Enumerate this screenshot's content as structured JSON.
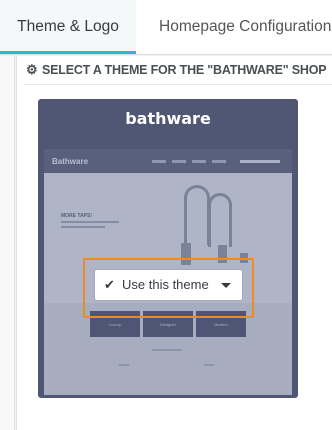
{
  "tabs": [
    {
      "label": "Theme & Logo",
      "active": true
    },
    {
      "label": "Homepage Configuration",
      "active": false
    }
  ],
  "section": {
    "icon": "cogs-icon",
    "title": "SELECT A THEME FOR THE \"BATHWARE\" SHOP"
  },
  "theme": {
    "name": "bathware",
    "preview": {
      "logo": "Bathware",
      "hero_title": "MORE TAPS!",
      "tiles": [
        "Luxury",
        "Designer",
        "Modern"
      ]
    },
    "action": {
      "icon": "check-icon",
      "label": "Use this theme",
      "caret_icon": "caret-down-icon"
    }
  },
  "colors": {
    "accent": "#25b9d7",
    "card": "#4f5775",
    "highlight": "#f08a24"
  }
}
